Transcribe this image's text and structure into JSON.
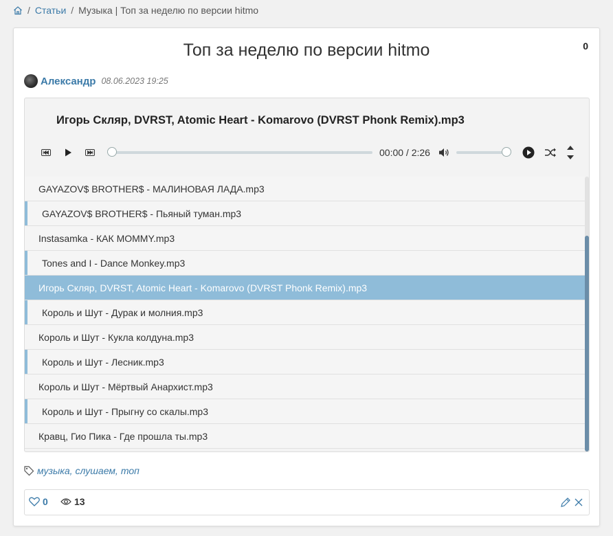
{
  "breadcrumb": {
    "home_icon": "home-icon",
    "sep1": "/",
    "section": "Статьи",
    "sep2": "/",
    "current": "Музыка | Топ за неделю по версии hitmo"
  },
  "article": {
    "title": "Топ за неделю по версии hitmo",
    "counter": "0",
    "author": "Александр",
    "date": "08.06.2023 19:25"
  },
  "player": {
    "now_playing": "Игорь Скляр, DVRST, Atomic Heart - Komarovo (DVRST Phonk Remix).mp3",
    "time": "00:00 / 2:26",
    "progress": 0.0,
    "volume": 1.0,
    "icons": [
      "prev-icon",
      "play-icon",
      "next-icon",
      "volume-icon",
      "play-circle-icon",
      "shuffle-icon",
      "sort-icon"
    ],
    "playlist": [
      "GAYAZOV$ BROTHER$ - МАЛИНОВАЯ ЛАДА.mp3",
      "GAYAZOV$ BROTHER$ - Пьяный туман.mp3",
      "Instasamka - КАК MOMMY.mp3",
      "Tones and I - Dance Monkey.mp3",
      "Игорь Скляр, DVRST, Atomic Heart - Komarovo (DVRST Phonk Remix).mp3",
      "Король и Шут - Дурак и молния.mp3",
      "Король и Шут - Кукла колдуна.mp3",
      "Король и Шут - Лесник.mp3",
      "Король и Шут - Мёртвый Анархист.mp3",
      "Король и Шут - Прыгну со скалы.mp3",
      "Кравц, Гио Пика - Где прошла ты.mp3"
    ],
    "active_index": 4
  },
  "tags": {
    "icon": "tag-icon",
    "items": [
      "музыка",
      "слушаем",
      "топ"
    ]
  },
  "footer": {
    "likes": "0",
    "views": "13",
    "icons": [
      "heart-icon",
      "eye-icon",
      "edit-icon",
      "close-icon"
    ]
  },
  "colors": {
    "link": "#3b7aa8",
    "active_row": "#8fbcd9",
    "scroll_thumb": "#6b8da8"
  }
}
